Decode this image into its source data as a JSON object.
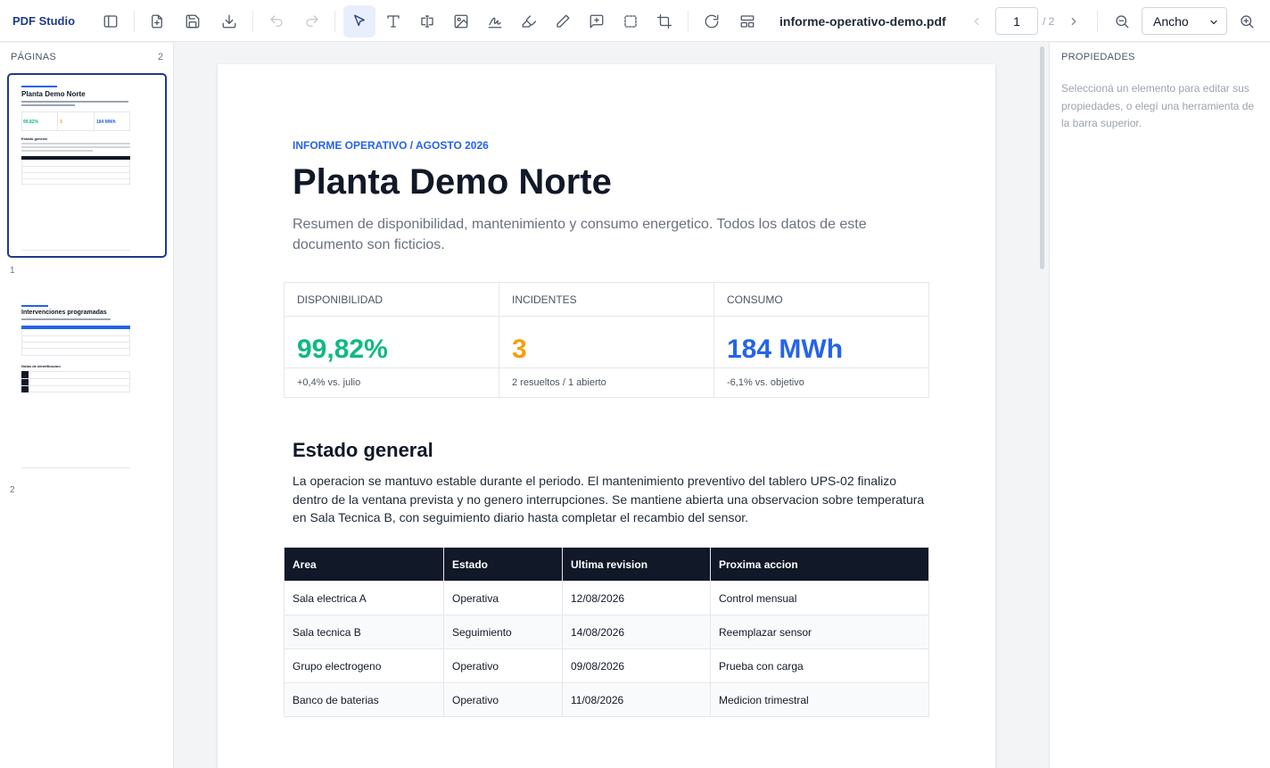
{
  "app": {
    "name": "PDF Studio"
  },
  "toolbar": {
    "filename": "informe-operativo-demo.pdf",
    "current_page": "1",
    "total_pages": "/ 2",
    "zoom_value": "Ancho",
    "icons": {
      "sidebar": "sidebar-icon",
      "new": "file-plus-icon",
      "save": "save-icon",
      "download": "download-icon",
      "undo": "undo-icon",
      "redo": "redo-icon",
      "select": "cursor-icon",
      "text": "text-icon",
      "textbox": "text-box-icon",
      "image": "image-icon",
      "signature": "signature-icon",
      "highlight": "highlighter-icon",
      "draw": "pencil-icon",
      "comment": "comment-icon",
      "shape": "rectangle-icon",
      "crop": "crop-icon",
      "rotate": "rotate-icon",
      "layout": "layout-icon",
      "prev": "chevron-left-icon",
      "next": "chevron-right-icon",
      "zoom_out": "zoom-out-icon",
      "zoom_in": "zoom-in-icon"
    }
  },
  "pages_panel": {
    "title": "PÁGINAS",
    "count": "2",
    "thumbnails": [
      {
        "label": "1",
        "title": "Planta Demo Norte",
        "kpis": [
          "99,82%",
          "3",
          "184 MWh"
        ],
        "section": "Estado general"
      },
      {
        "label": "2",
        "title": "Intervenciones programadas",
        "section": "Notas de identificacion"
      }
    ]
  },
  "document": {
    "eyebrow": "INFORME OPERATIVO / AGOSTO 2026",
    "title": "Planta Demo Norte",
    "subtitle": "Resumen de disponibilidad, mantenimiento y consumo energetico. Todos los datos de este documento son ficticios.",
    "kpis": [
      {
        "label": "DISPONIBILIDAD",
        "value": "99,82%",
        "note": "+0,4% vs. julio",
        "color": "#10b981"
      },
      {
        "label": "INCIDENTES",
        "value": "3",
        "note": "2 resueltos / 1 abierto",
        "color": "#f59e0b"
      },
      {
        "label": "CONSUMO",
        "value": "184 MWh",
        "note": "-6,1% vs. objetivo",
        "color": "#2563eb"
      }
    ],
    "section_title": "Estado general",
    "section_body": "La operacion se mantuvo estable durante el periodo. El mantenimiento preventivo del tablero UPS-02 finalizo dentro de la ventana prevista y no genero interrupciones. Se mantiene abierta una observacion sobre temperatura en Sala Tecnica B, con seguimiento diario hasta completar el recambio del sensor.",
    "table": {
      "headers": [
        "Area",
        "Estado",
        "Ultima revision",
        "Proxima accion"
      ],
      "rows": [
        [
          "Sala electrica A",
          "Operativa",
          "12/08/2026",
          "Control mensual"
        ],
        [
          "Sala tecnica B",
          "Seguimiento",
          "14/08/2026",
          "Reemplazar sensor"
        ],
        [
          "Grupo electrogeno",
          "Operativo",
          "09/08/2026",
          "Prueba con carga"
        ],
        [
          "Banco de baterias",
          "Operativo",
          "11/08/2026",
          "Medicion trimestral"
        ]
      ]
    }
  },
  "properties_panel": {
    "title": "PROPIEDADES",
    "hint": "Seleccioná un elemento para editar sus propiedades, o elegí una herramienta de la barra superior."
  }
}
